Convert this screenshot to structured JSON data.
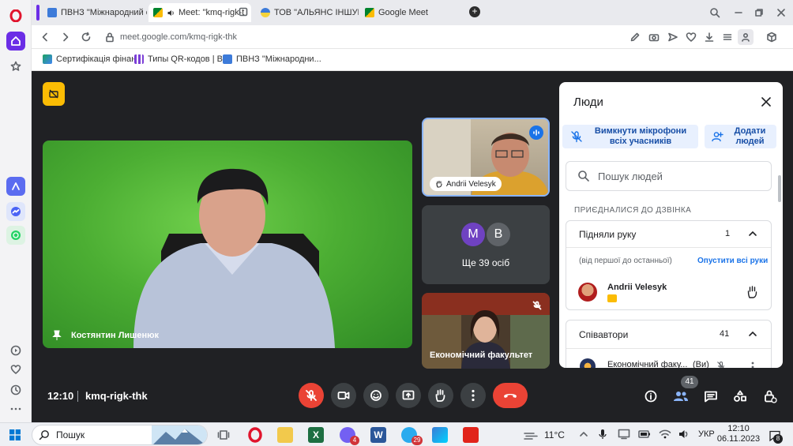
{
  "tabs": [
    {
      "label": "ПВНЗ \"Міжнародний ек"
    },
    {
      "label": "Meet: \"kmq-rigk-t"
    },
    {
      "label": "ТОВ \"АЛЬЯНС ІНШУРЕН"
    },
    {
      "label": "Google Meet"
    }
  ],
  "address": {
    "url": "meet.google.com/kmq-rigk-thk"
  },
  "bookmarks": [
    {
      "label": "Сертифікація фінан..."
    },
    {
      "label": "Типы QR-кодов | В..."
    },
    {
      "label": "ПВНЗ \"Міжнародни..."
    }
  ],
  "meet": {
    "main_speaker": "Костянтин Лишенюк",
    "tile_1_name": "Andrii Velesyk",
    "tile_more_label": "Ще 39 осіб",
    "tile_more_avatars": [
      "M",
      "B"
    ],
    "tile_3_name": "Економічний факультет",
    "time": "12:10",
    "meeting_code": "kmq-rigk-thk",
    "people_count_badge": "41"
  },
  "people_panel": {
    "title": "Люди",
    "mute_all": "Вимкнути мікрофони всіх учасників",
    "add_people": "Додати людей",
    "search_placeholder": "Пошук людей",
    "section_joined": "ПРИЄДНАЛИСЯ ДО ДЗВІНКА",
    "raised_hands": {
      "label": "Підняли руку",
      "count": "1",
      "order_hint": "(від першої до останньої)",
      "lower_all": "Опустити всі руки",
      "person": "Andrii Velesyk"
    },
    "coauthors": {
      "label": "Співавтори",
      "count": "41",
      "person": "Економічний факу...",
      "you_tag": "(Ви)"
    }
  },
  "taskbar": {
    "search": "Пошук",
    "temperature": "11°C",
    "lang": "УКР",
    "time": "12:10",
    "date": "06.11.2023",
    "badges": {
      "viber": "4",
      "telegram": "29",
      "notifications": "8"
    }
  }
}
